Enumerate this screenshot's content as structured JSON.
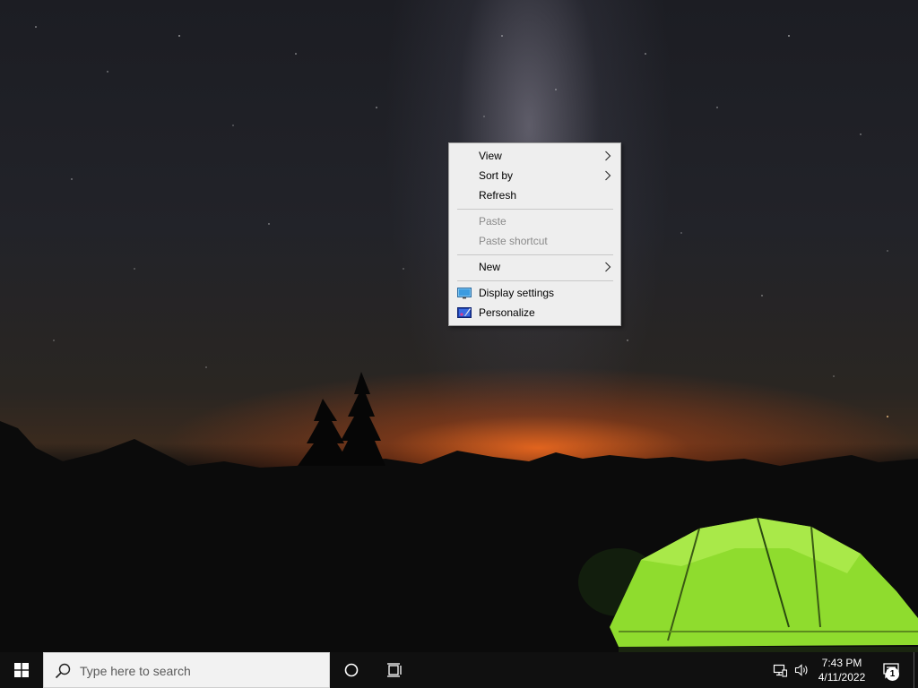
{
  "context_menu": {
    "items": [
      {
        "label": "View",
        "submenu": true,
        "disabled": false
      },
      {
        "label": "Sort by",
        "submenu": true,
        "disabled": false
      },
      {
        "label": "Refresh",
        "submenu": false,
        "disabled": false
      },
      {
        "label": "Paste",
        "submenu": false,
        "disabled": true
      },
      {
        "label": "Paste shortcut",
        "submenu": false,
        "disabled": true
      },
      {
        "label": "New",
        "submenu": true,
        "disabled": false
      },
      {
        "label": "Display settings",
        "submenu": false,
        "disabled": false,
        "icon": "display-settings-icon"
      },
      {
        "label": "Personalize",
        "submenu": false,
        "disabled": false,
        "icon": "personalize-icon"
      }
    ]
  },
  "taskbar": {
    "search_placeholder": "Type here to search",
    "clock_time": "7:43 PM",
    "clock_date": "4/11/2022",
    "notification_count": "1",
    "icons": {
      "start": "windows-logo-icon",
      "search": "search-icon",
      "cortana": "cortana-circle-icon",
      "task_view": "task-view-icon",
      "network": "network-icon",
      "volume": "volume-icon",
      "action_center": "action-center-icon"
    }
  },
  "colors": {
    "taskbar": "#101010",
    "menu_background": "#eeeeee",
    "tent_green": "#8fdc2e",
    "sunset_orange": "#ff6e1e"
  }
}
